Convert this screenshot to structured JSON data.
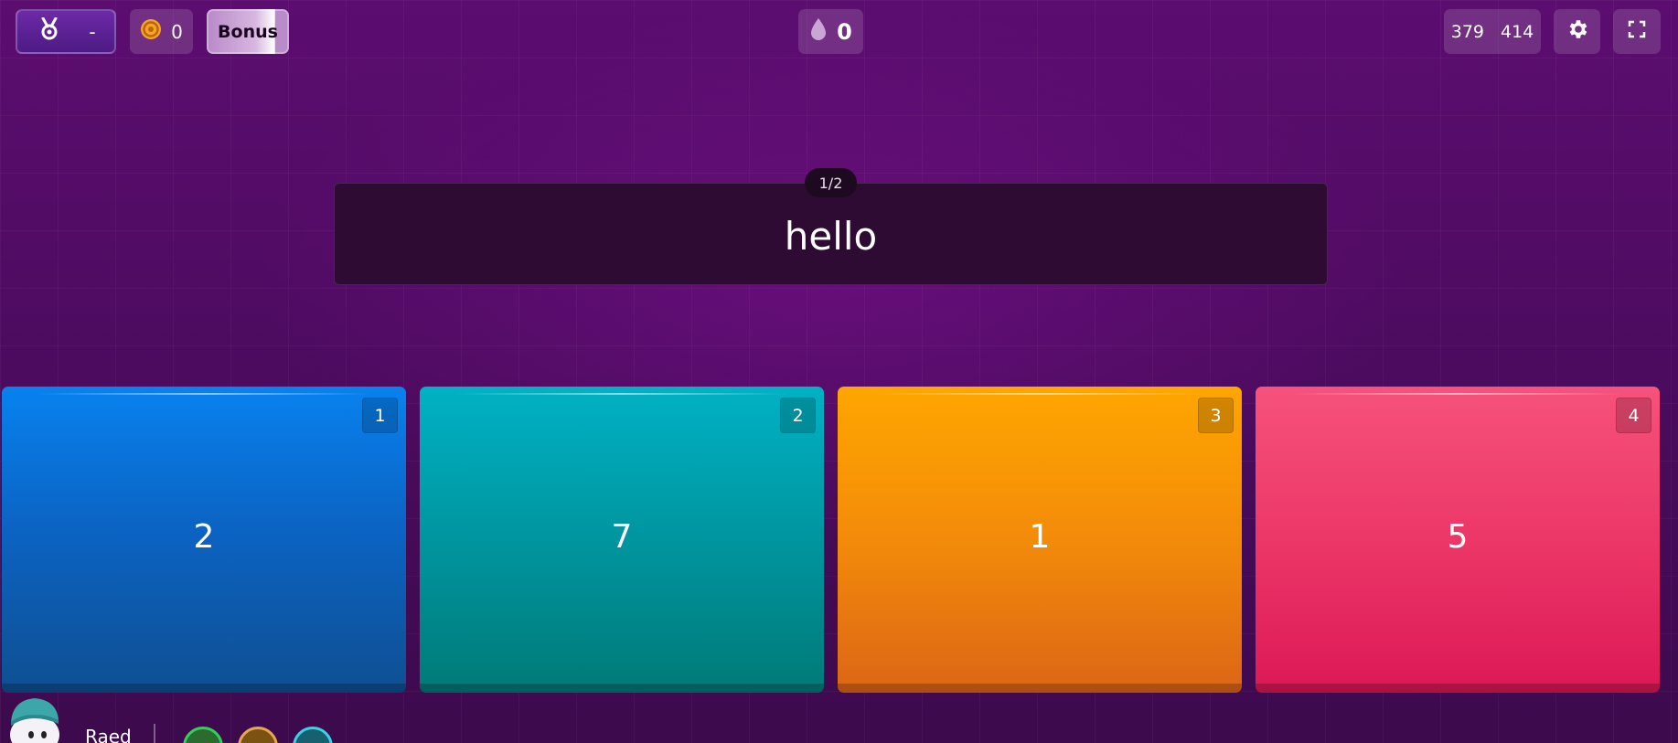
{
  "header": {
    "rank_value": "-",
    "coins": "0",
    "bonus_label": "Bonus",
    "streak": "0",
    "score_left": "379",
    "score_right": "414"
  },
  "question": {
    "counter": "1/2",
    "text": "hello"
  },
  "answers": [
    {
      "key": "1",
      "text": "2",
      "color": "#0b64c4"
    },
    {
      "key": "2",
      "text": "7",
      "color": "#0098a3"
    },
    {
      "key": "3",
      "text": "1",
      "color": "#f38b0a"
    },
    {
      "key": "4",
      "text": "5",
      "color": "#ec3768"
    }
  ],
  "player": {
    "name": "Raed"
  },
  "icons": {
    "rank": "medal-icon",
    "coins": "coin-icon",
    "streak": "drop-icon",
    "settings": "gear-icon",
    "fullscreen": "fullscreen-icon"
  },
  "theme": {
    "background": "#4a0b5d",
    "question_card": "#2d0b32"
  }
}
